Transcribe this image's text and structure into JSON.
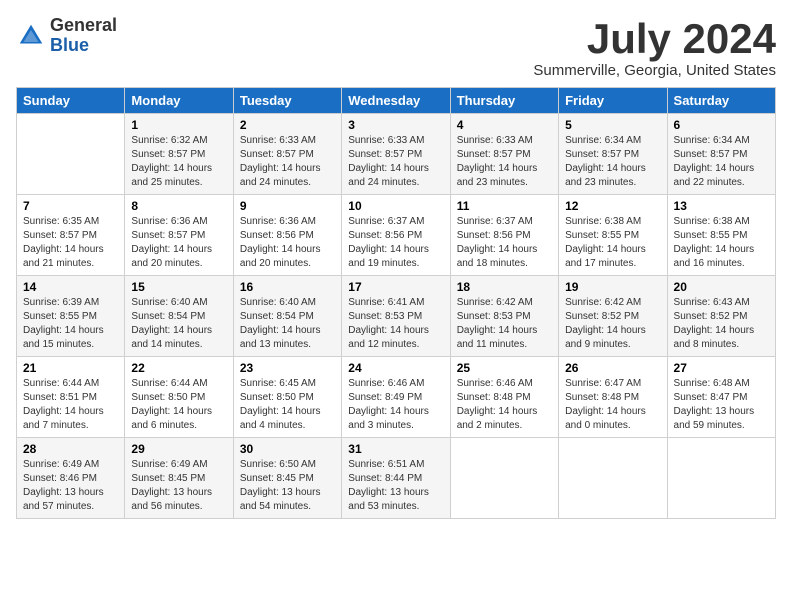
{
  "header": {
    "logo_general": "General",
    "logo_blue": "Blue",
    "month_title": "July 2024",
    "location": "Summerville, Georgia, United States"
  },
  "calendar": {
    "days_of_week": [
      "Sunday",
      "Monday",
      "Tuesday",
      "Wednesday",
      "Thursday",
      "Friday",
      "Saturday"
    ],
    "weeks": [
      [
        {
          "day": "",
          "info": ""
        },
        {
          "day": "1",
          "info": "Sunrise: 6:32 AM\nSunset: 8:57 PM\nDaylight: 14 hours\nand 25 minutes."
        },
        {
          "day": "2",
          "info": "Sunrise: 6:33 AM\nSunset: 8:57 PM\nDaylight: 14 hours\nand 24 minutes."
        },
        {
          "day": "3",
          "info": "Sunrise: 6:33 AM\nSunset: 8:57 PM\nDaylight: 14 hours\nand 24 minutes."
        },
        {
          "day": "4",
          "info": "Sunrise: 6:33 AM\nSunset: 8:57 PM\nDaylight: 14 hours\nand 23 minutes."
        },
        {
          "day": "5",
          "info": "Sunrise: 6:34 AM\nSunset: 8:57 PM\nDaylight: 14 hours\nand 23 minutes."
        },
        {
          "day": "6",
          "info": "Sunrise: 6:34 AM\nSunset: 8:57 PM\nDaylight: 14 hours\nand 22 minutes."
        }
      ],
      [
        {
          "day": "7",
          "info": "Sunrise: 6:35 AM\nSunset: 8:57 PM\nDaylight: 14 hours\nand 21 minutes."
        },
        {
          "day": "8",
          "info": "Sunrise: 6:36 AM\nSunset: 8:57 PM\nDaylight: 14 hours\nand 20 minutes."
        },
        {
          "day": "9",
          "info": "Sunrise: 6:36 AM\nSunset: 8:56 PM\nDaylight: 14 hours\nand 20 minutes."
        },
        {
          "day": "10",
          "info": "Sunrise: 6:37 AM\nSunset: 8:56 PM\nDaylight: 14 hours\nand 19 minutes."
        },
        {
          "day": "11",
          "info": "Sunrise: 6:37 AM\nSunset: 8:56 PM\nDaylight: 14 hours\nand 18 minutes."
        },
        {
          "day": "12",
          "info": "Sunrise: 6:38 AM\nSunset: 8:55 PM\nDaylight: 14 hours\nand 17 minutes."
        },
        {
          "day": "13",
          "info": "Sunrise: 6:38 AM\nSunset: 8:55 PM\nDaylight: 14 hours\nand 16 minutes."
        }
      ],
      [
        {
          "day": "14",
          "info": "Sunrise: 6:39 AM\nSunset: 8:55 PM\nDaylight: 14 hours\nand 15 minutes."
        },
        {
          "day": "15",
          "info": "Sunrise: 6:40 AM\nSunset: 8:54 PM\nDaylight: 14 hours\nand 14 minutes."
        },
        {
          "day": "16",
          "info": "Sunrise: 6:40 AM\nSunset: 8:54 PM\nDaylight: 14 hours\nand 13 minutes."
        },
        {
          "day": "17",
          "info": "Sunrise: 6:41 AM\nSunset: 8:53 PM\nDaylight: 14 hours\nand 12 minutes."
        },
        {
          "day": "18",
          "info": "Sunrise: 6:42 AM\nSunset: 8:53 PM\nDaylight: 14 hours\nand 11 minutes."
        },
        {
          "day": "19",
          "info": "Sunrise: 6:42 AM\nSunset: 8:52 PM\nDaylight: 14 hours\nand 9 minutes."
        },
        {
          "day": "20",
          "info": "Sunrise: 6:43 AM\nSunset: 8:52 PM\nDaylight: 14 hours\nand 8 minutes."
        }
      ],
      [
        {
          "day": "21",
          "info": "Sunrise: 6:44 AM\nSunset: 8:51 PM\nDaylight: 14 hours\nand 7 minutes."
        },
        {
          "day": "22",
          "info": "Sunrise: 6:44 AM\nSunset: 8:50 PM\nDaylight: 14 hours\nand 6 minutes."
        },
        {
          "day": "23",
          "info": "Sunrise: 6:45 AM\nSunset: 8:50 PM\nDaylight: 14 hours\nand 4 minutes."
        },
        {
          "day": "24",
          "info": "Sunrise: 6:46 AM\nSunset: 8:49 PM\nDaylight: 14 hours\nand 3 minutes."
        },
        {
          "day": "25",
          "info": "Sunrise: 6:46 AM\nSunset: 8:48 PM\nDaylight: 14 hours\nand 2 minutes."
        },
        {
          "day": "26",
          "info": "Sunrise: 6:47 AM\nSunset: 8:48 PM\nDaylight: 14 hours\nand 0 minutes."
        },
        {
          "day": "27",
          "info": "Sunrise: 6:48 AM\nSunset: 8:47 PM\nDaylight: 13 hours\nand 59 minutes."
        }
      ],
      [
        {
          "day": "28",
          "info": "Sunrise: 6:49 AM\nSunset: 8:46 PM\nDaylight: 13 hours\nand 57 minutes."
        },
        {
          "day": "29",
          "info": "Sunrise: 6:49 AM\nSunset: 8:45 PM\nDaylight: 13 hours\nand 56 minutes."
        },
        {
          "day": "30",
          "info": "Sunrise: 6:50 AM\nSunset: 8:45 PM\nDaylight: 13 hours\nand 54 minutes."
        },
        {
          "day": "31",
          "info": "Sunrise: 6:51 AM\nSunset: 8:44 PM\nDaylight: 13 hours\nand 53 minutes."
        },
        {
          "day": "",
          "info": ""
        },
        {
          "day": "",
          "info": ""
        },
        {
          "day": "",
          "info": ""
        }
      ]
    ]
  }
}
